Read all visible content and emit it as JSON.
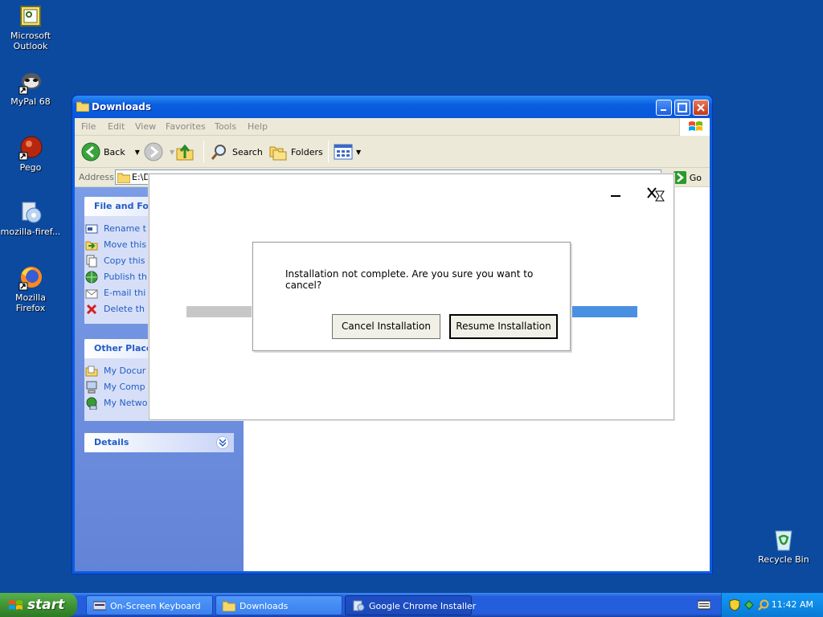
{
  "desktop": {
    "icons": [
      {
        "label_line1": "Microsoft",
        "label_line2": "Outlook"
      },
      {
        "label_line1": "MyPal 68",
        "label_line2": ""
      },
      {
        "label_line1": "Pego",
        "label_line2": ""
      },
      {
        "label_line1": "mozilla-firef...",
        "label_line2": ""
      },
      {
        "label_line1": "Mozilla Firefox",
        "label_line2": ""
      }
    ],
    "recycle_bin": "Recycle Bin"
  },
  "explorer": {
    "title": "Downloads",
    "menu": [
      "File",
      "Edit",
      "View",
      "Favorites",
      "Tools",
      "Help"
    ],
    "toolbar": {
      "back": "Back",
      "search": "Search",
      "folders": "Folders"
    },
    "address": {
      "label": "Address",
      "value": "E:\\D",
      "go": "Go"
    },
    "taskpane": {
      "file_tasks": {
        "title": "File and Folc",
        "items": [
          "Rename t",
          "Move this",
          "Copy this",
          "Publish th",
          "E-mail thi",
          "Delete th"
        ]
      },
      "other_places": {
        "title": "Other Places",
        "items": [
          "My Docur",
          "My Comp",
          "My Netwo"
        ]
      },
      "details": {
        "title": "Details"
      }
    }
  },
  "installer": {
    "dialog": {
      "message": "Installation not complete. Are you sure you want to cancel?",
      "cancel_label": "Cancel Installation",
      "resume_label": "Resume Installation"
    }
  },
  "taskbar": {
    "start": "start",
    "tasks": [
      "On-Screen Keyboard",
      "Downloads",
      "Google Chrome Installer"
    ],
    "clock": "11:42 AM"
  },
  "colors": {
    "desktop": "#0c4aa0",
    "xp_blue": "#0a5ee0",
    "taskpane_link": "#215dc6",
    "start_green": "#3c8f31"
  }
}
